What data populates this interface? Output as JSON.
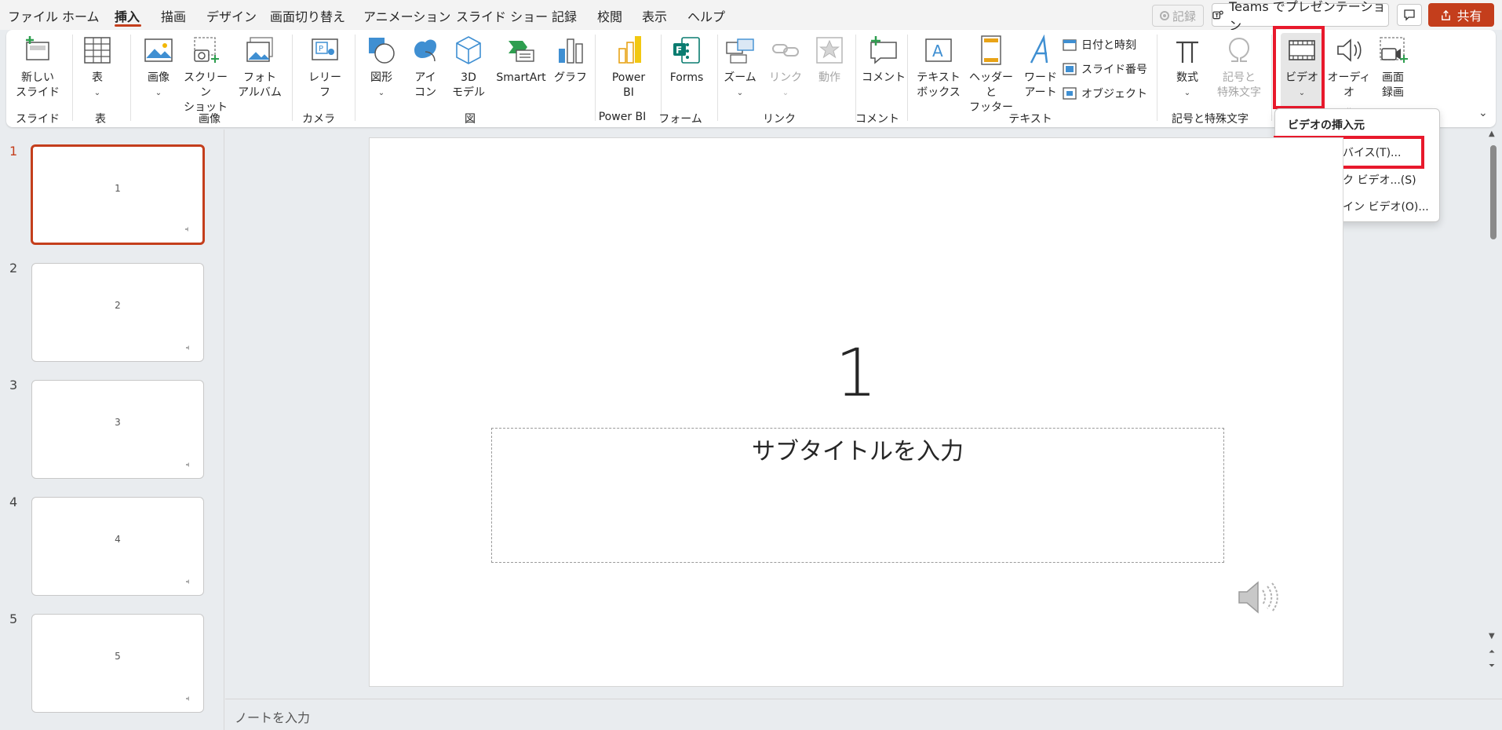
{
  "menu": {
    "items": [
      "ファイル",
      "ホーム",
      "挿入",
      "描画",
      "デザイン",
      "画面切り替え",
      "アニメーション",
      "スライド ショー",
      "記録",
      "校閲",
      "表示",
      "ヘルプ"
    ],
    "active_index": 2,
    "record_button": "記録",
    "teams_button": "Teams でプレゼンテーション",
    "share_button": "共有"
  },
  "ribbon": {
    "new_slide": "新しい\nスライド",
    "table": "表",
    "image": "画像",
    "screenshot": "スクリーン\nショット",
    "photo_album": "フォト\nアルバム",
    "cameo": "レリー\nフ",
    "shapes": "図形",
    "icons": "アイ\nコン",
    "models3d": "3D\nモデル",
    "smartart": "SmartArt",
    "chart": "グラフ",
    "powerbi": "Power\nBI",
    "forms": "Forms",
    "zoom": "ズーム",
    "link": "リンク",
    "action": "動作",
    "comment": "コメント",
    "textbox": "テキスト\nボックス",
    "header_footer": "ヘッダーと\nフッター",
    "wordart": "ワード\nアート",
    "date_time": "日付と時刻",
    "slide_number": "スライド番号",
    "object": "オブジェクト",
    "equation": "数式",
    "symbol": "記号と\n特殊文字",
    "video": "ビデオ",
    "audio": "オーディオ",
    "screen_recording": "画面\n録画",
    "groups": {
      "slides": "スライド",
      "tables": "表",
      "images": "画像",
      "camera": "カメラ",
      "illustrations": "図",
      "powerbi": "Power BI",
      "forms": "フォーム",
      "links": "リンク",
      "comments": "コメント",
      "text": "テキスト",
      "symbols": "記号と特殊文字"
    }
  },
  "video_menu": {
    "header": "ビデオの挿入元",
    "items": [
      "このデバイス(T)...",
      "ストック ビデオ...(S)",
      "オンライン ビデオ(O)..."
    ]
  },
  "slides": {
    "thumbnails": [
      {
        "number": "1",
        "text": "1"
      },
      {
        "number": "2",
        "text": "2"
      },
      {
        "number": "3",
        "text": "3"
      },
      {
        "number": "4",
        "text": "4"
      },
      {
        "number": "5",
        "text": "5"
      }
    ],
    "active_index": 0
  },
  "main_slide": {
    "title": "1",
    "subtitle_placeholder": "サブタイトルを入力"
  },
  "notes": {
    "placeholder": "ノートを入力"
  },
  "colors": {
    "accent": "#c43e1c",
    "highlight": "#e8192c"
  }
}
